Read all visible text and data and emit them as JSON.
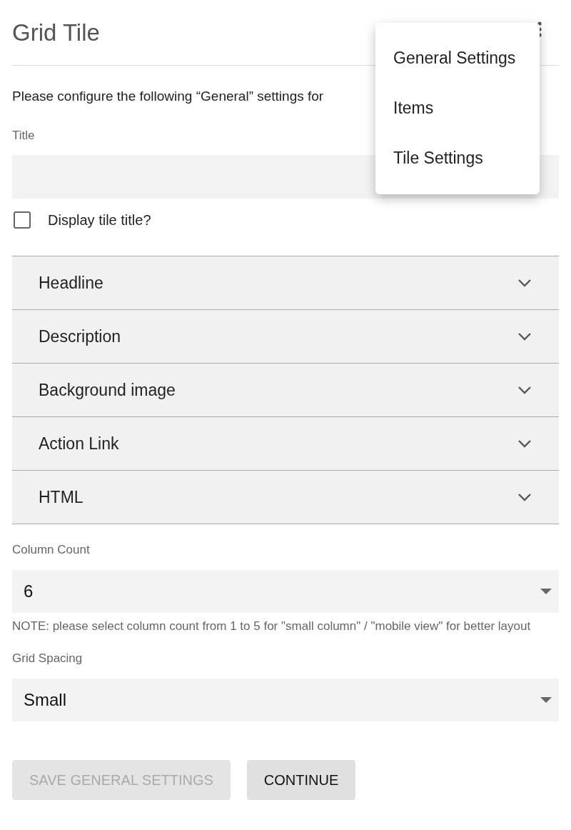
{
  "header": {
    "title": "Grid Tile"
  },
  "menu": {
    "items": [
      {
        "label": "General Settings"
      },
      {
        "label": "Items"
      },
      {
        "label": "Tile Settings"
      }
    ]
  },
  "intro": "Please configure the following “General” settings for",
  "title_field": {
    "label": "Title"
  },
  "display_title": {
    "label": "Display tile title?",
    "checked": false
  },
  "sections": [
    {
      "label": "Headline",
      "expanded": false
    },
    {
      "label": "Description",
      "expanded": false
    },
    {
      "label": "Background image",
      "expanded": false
    },
    {
      "label": "Action Link",
      "expanded": false
    },
    {
      "label": "HTML",
      "expanded": false
    }
  ],
  "column_count": {
    "label": "Column Count",
    "value": "6",
    "note": "NOTE: please select column count from 1 to 5 for \"small column\" / \"mobile view\" for better layout"
  },
  "grid_spacing": {
    "label": "Grid Spacing",
    "value": "Small"
  },
  "buttons": [
    {
      "label": "SAVE GENERAL SETTINGS",
      "disabled": true
    },
    {
      "label": "CONTINUE",
      "disabled": false
    }
  ]
}
